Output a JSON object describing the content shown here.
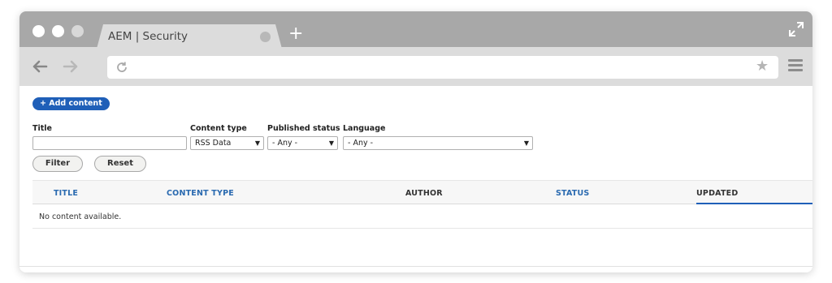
{
  "browser": {
    "tab_title": "AEM | Security",
    "new_tab_label": "+",
    "star_glyph": "★"
  },
  "page": {
    "add_button_label": "+ Add content",
    "filters": {
      "title_label": "Title",
      "title_value": "",
      "content_type_label": "Content type",
      "content_type_value": "RSS Data",
      "published_status_label": "Published status",
      "published_status_value": "- Any -",
      "language_label": "Language",
      "language_value": "- Any -"
    },
    "filter_button_label": "Filter",
    "reset_button_label": "Reset",
    "table": {
      "columns": [
        "TITLE",
        "CONTENT TYPE",
        "AUTHOR",
        "STATUS",
        "UPDATED"
      ],
      "empty_text": "No content available."
    },
    "colors": {
      "accent": "#1f5fb8",
      "link": "#2a6ab0",
      "chrome": "#a8a8a8"
    }
  }
}
